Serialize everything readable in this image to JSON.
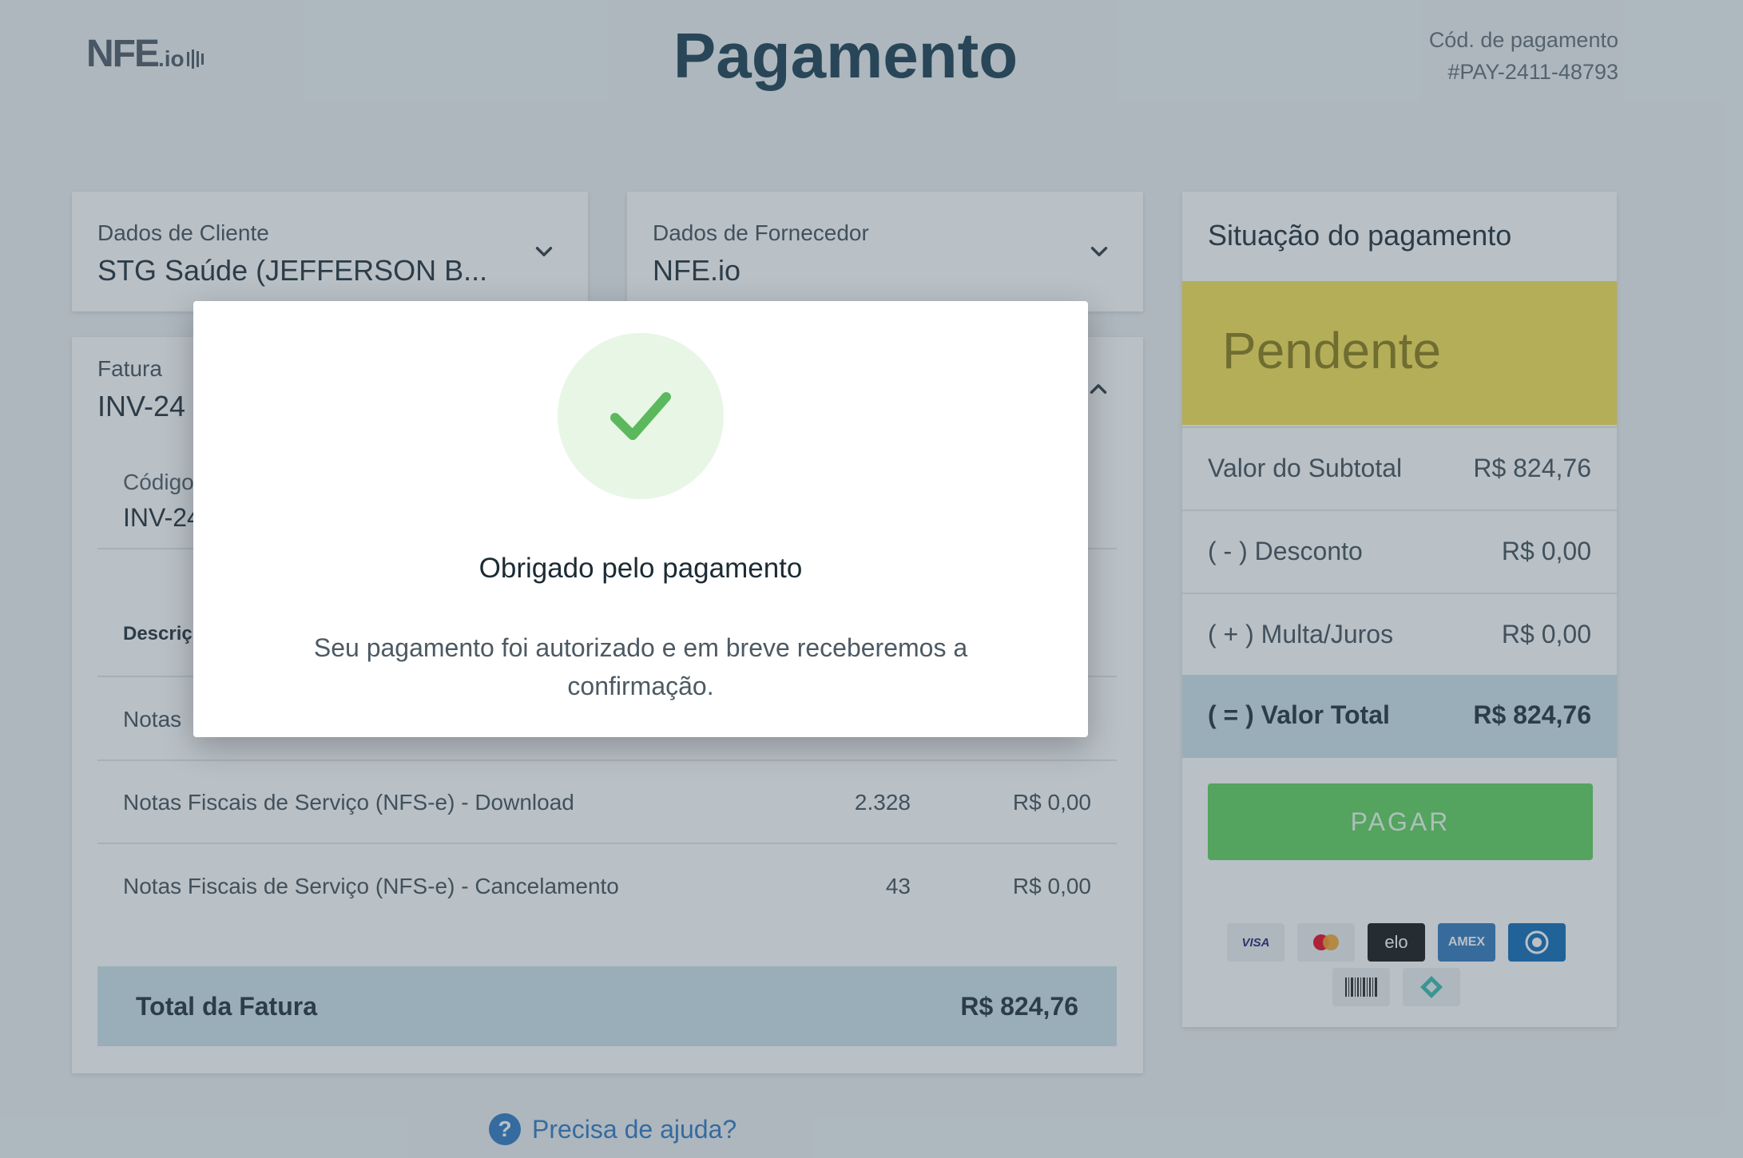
{
  "header": {
    "logo_main": "NFE",
    "logo_sub": ".io",
    "title": "Pagamento",
    "pay_code_label": "Cód. de pagamento",
    "pay_code": "#PAY-2411-48793"
  },
  "client": {
    "label": "Dados de Cliente",
    "value": "STG Saúde (JEFFERSON B..."
  },
  "supplier": {
    "label": "Dados de Fornecedor",
    "value": "NFE.io"
  },
  "invoice": {
    "label": "Fatura",
    "value_partial": "INV-24",
    "code_label_partial": "Código",
    "code_value_partial": "INV-24",
    "desc_header_partial": "Descriç",
    "rows": [
      {
        "description": "Notas",
        "qty": "",
        "amount": ""
      },
      {
        "description": "Notas Fiscais de Serviço (NFS-e) - Download",
        "qty": "2.328",
        "amount": "R$ 0,00"
      },
      {
        "description": "Notas Fiscais de Serviço (NFS-e) - Cancelamento",
        "qty": "43",
        "amount": "R$ 0,00"
      }
    ],
    "total_label": "Total da Fatura",
    "total_value": "R$ 824,76"
  },
  "help": {
    "label": "Precisa de ajuda?",
    "icon": "question-icon"
  },
  "status": {
    "title": "Situação do pagamento",
    "state": "Pendente",
    "state_color": "#f7e34f",
    "summary": [
      {
        "label": "Valor do Subtotal",
        "value": "R$ 824,76"
      },
      {
        "label": "( - ) Desconto",
        "value": "R$ 0,00"
      },
      {
        "label": "( + ) Multa/Juros",
        "value": "R$ 0,00"
      }
    ],
    "total_label": "( = ) Valor Total",
    "total_value": "R$ 824,76",
    "pay_button": "PAGAR",
    "pay_button_color": "#5cd058",
    "methods": [
      {
        "name": "visa-icon",
        "text": "VISA"
      },
      {
        "name": "mastercard-icon",
        "text": ""
      },
      {
        "name": "elo-icon",
        "text": "elo"
      },
      {
        "name": "amex-icon",
        "text": "AMEX"
      },
      {
        "name": "diners-icon",
        "text": ""
      },
      {
        "name": "barcode-icon",
        "text": ""
      },
      {
        "name": "pix-icon",
        "text": ""
      }
    ]
  },
  "modal": {
    "icon": "check-icon",
    "title": "Obrigado pelo pagamento",
    "body": "Seu pagamento foi autorizado e em breve receberemos a confirmação."
  }
}
